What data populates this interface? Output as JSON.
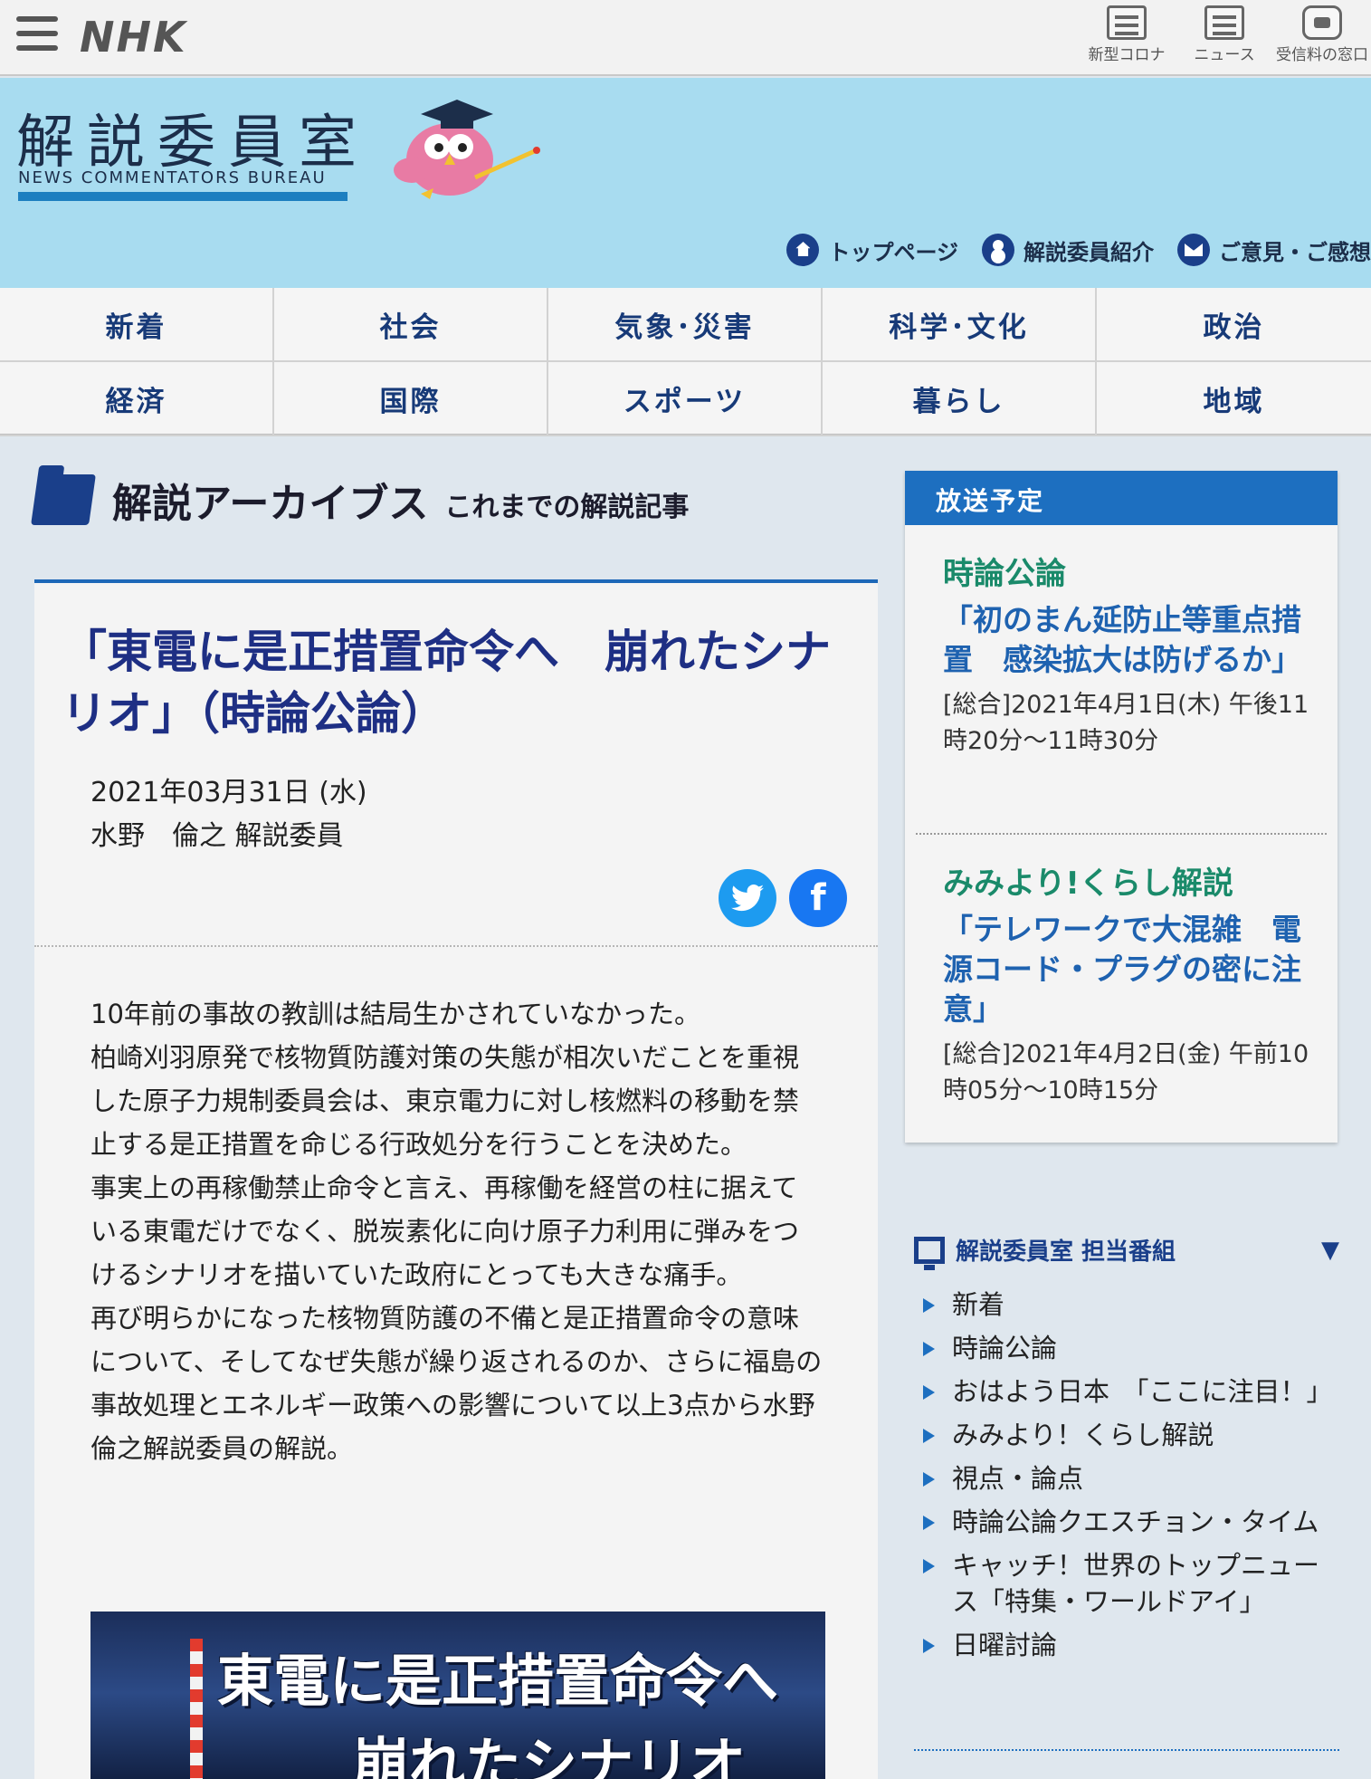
{
  "topbar": {
    "logo": "NHK",
    "links": [
      {
        "label": "新型コロナ",
        "icon": "newspaper-icon"
      },
      {
        "label": "ニュース",
        "icon": "news-icon"
      },
      {
        "label": "受信料の窓口",
        "icon": "tv-icon"
      }
    ]
  },
  "banner": {
    "title": "解説委員室",
    "subtitle": "NEWS COMMENTATORS BUREAU",
    "nav": [
      {
        "label": "トップページ",
        "icon": "home-icon"
      },
      {
        "label": "解説委員紹介",
        "icon": "person-icon"
      },
      {
        "label": "ご意見・ご感想",
        "icon": "mail-icon"
      }
    ]
  },
  "categories": [
    "新着",
    "社会",
    "気象･災害",
    "科学･文化",
    "政治",
    "経済",
    "国際",
    "スポーツ",
    "暮らし",
    "地域"
  ],
  "archive": {
    "title": "解説アーカイブス",
    "subtitle": "これまでの解説記事"
  },
  "article": {
    "title": "「東電に是正措置命令へ　崩れたシナリオ」（時論公論）",
    "date": "2021年03月31日 (水)",
    "author": "水野　倫之  解説委員",
    "body": [
      "10年前の事故の教訓は結局生かされていなかった。",
      "柏崎刈羽原発で核物質防護対策の失態が相次いだことを重視した原子力規制委員会は、東京電力に対し核燃料の移動を禁止する是正措置を命じる行政処分を行うことを決めた。",
      "事実上の再稼働禁止命令と言え、再稼働を経営の柱に据えている東電だけでなく、脱炭素化に向け原子力利用に弾みをつけるシナリオを描いていた政府にとっても大きな痛手。",
      "再び明らかになった核物質防護の不備と是正措置命令の意味について、そしてなぜ失態が繰り返されるのか、さらに福島の事故処理とエネルギー政策への影響について以上3点から水野倫之解説委員の解説。"
    ],
    "image_text_1": "東電に是正措置命令へ",
    "image_text_2": "崩れたシナリオ"
  },
  "schedule": {
    "header": "放送予定",
    "items": [
      {
        "program": "時論公論",
        "title": "「初のまん延防止等重点措置　感染拡大は防げるか」",
        "time": "[総合]2021年4月1日(木) 午後11時20分～11時30分"
      },
      {
        "program": "みみより!くらし解説",
        "title": "「テレワークで大混雑　電源コード・プラグの密に注意」",
        "time": "[総合]2021年4月2日(金) 午前10時05分～10時15分"
      }
    ]
  },
  "programs": {
    "header": "解説委員室 担当番組",
    "toggle": "▼",
    "items": [
      "新着",
      "時論公論",
      "おはよう日本　「ここに注目！」",
      "みみより！くらし解説",
      "視点・論点",
      "時論公論クエスチョン・タイム",
      "キャッチ！世界のトップニュース「特集・ワールドアイ」",
      "日曜討論"
    ]
  },
  "colors": {
    "accent": "#1d6fc0",
    "banner": "#a8dcf0",
    "title_navy": "#1e2f84",
    "program_green": "#1a8a6a"
  }
}
